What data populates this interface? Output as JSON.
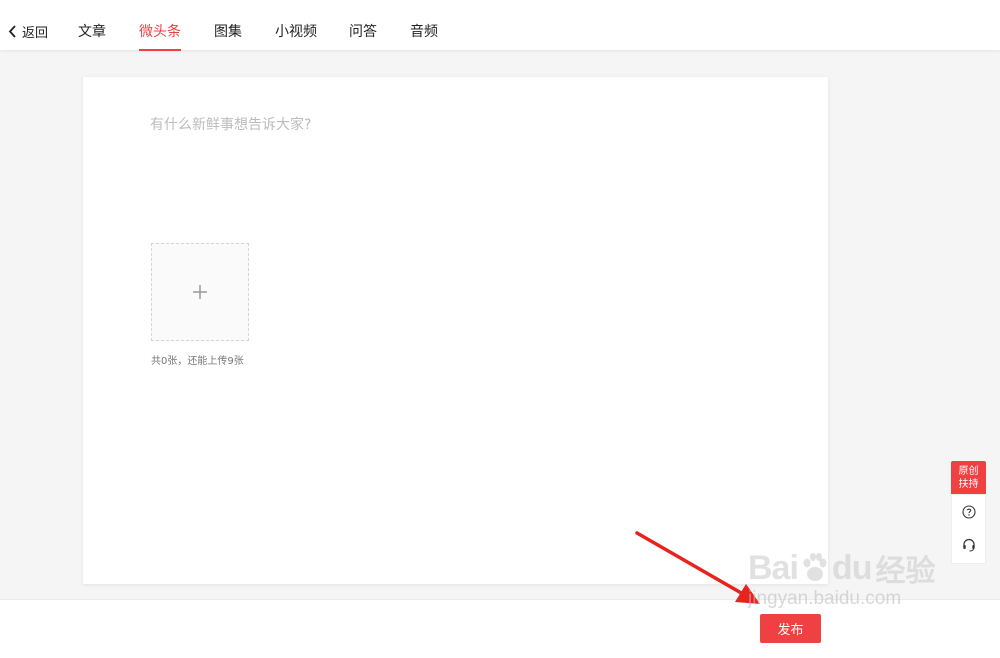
{
  "nav": {
    "back_label": "返回",
    "tabs": [
      {
        "label": "文章"
      },
      {
        "label": "微头条",
        "active": true
      },
      {
        "label": "图集"
      },
      {
        "label": "小视频"
      },
      {
        "label": "问答"
      },
      {
        "label": "音频"
      }
    ]
  },
  "editor": {
    "placeholder": "有什么新鲜事想告诉大家?",
    "upload_hint": "共0张，还能上传9张"
  },
  "footer": {
    "publish_label": "发布"
  },
  "side_tools": {
    "original_support_line1": "原创",
    "original_support_line2": "扶持",
    "icons": [
      "help-icon",
      "customer-service-icon"
    ]
  },
  "watermark": {
    "brand": "Bai",
    "brand2": "du",
    "cn": "经验",
    "url": "jingyan.baidu.com"
  },
  "colors": {
    "accent": "#f04142",
    "annotation_arrow": "#e8231e"
  }
}
